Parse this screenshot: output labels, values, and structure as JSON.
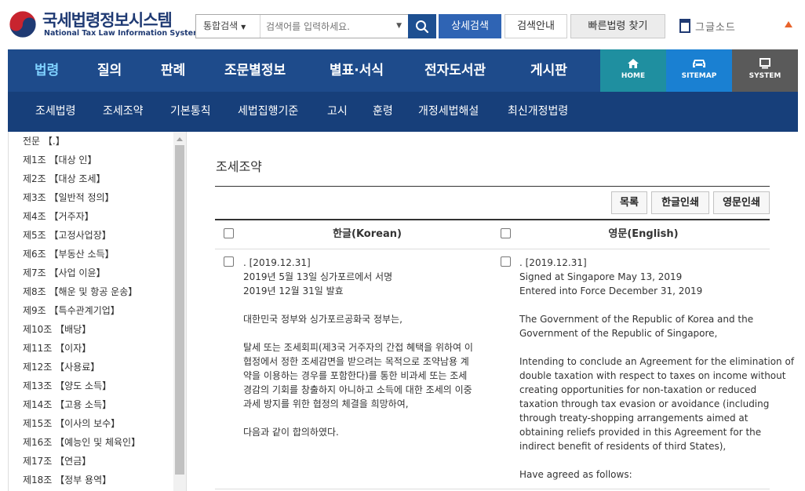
{
  "logo": {
    "title_ko": "국세법령정보시스템",
    "title_en": "National Tax Law Information System"
  },
  "search": {
    "scope": "통합검색",
    "placeholder": "검색어를 입력하세요.",
    "detail_button": "상세검색",
    "guide_button": "검색안내",
    "quick_button": "빠른법령 찾기"
  },
  "header": {
    "util_text": "그글소드"
  },
  "nav": {
    "main": [
      {
        "label": "법령",
        "active": true
      },
      {
        "label": "질의"
      },
      {
        "label": "판례"
      },
      {
        "label": "조문별정보"
      },
      {
        "label": "별표·서식"
      },
      {
        "label": "전자도서관"
      },
      {
        "label": "게시판"
      }
    ],
    "sub": [
      "조세법령",
      "조세조약",
      "기본통칙",
      "세법집행기준",
      "고시",
      "훈령",
      "개정세법해설",
      "최신개정법령"
    ],
    "quick": {
      "home": "HOME",
      "sitemap": "SITEMAP",
      "system": "SYSTEM"
    },
    "colors": {
      "nav_bg": "#1e4b8b",
      "sub_bg": "#173f7a",
      "active": "#7fd1ff",
      "home": "#1f8fa0",
      "sitemap": "#1a80d2",
      "system": "#5a5a5a"
    }
  },
  "sidebar": {
    "items": [
      "전문 【.】",
      "제1조 【대상 인】",
      "제2조 【대상 조세】",
      "제3조 【일반적 정의】",
      "제4조 【거주자】",
      "제5조 【고정사업장】",
      "제6조 【부동산 소득】",
      "제7조 【사업 이윤】",
      "제8조 【해운 및 항공 운송】",
      "제9조 【특수관계기업】",
      "제10조 【배당】",
      "제11조 【이자】",
      "제12조 【사용료】",
      "제13조 【양도 소득】",
      "제14조 【고용 소득】",
      "제15조 【이사의 보수】",
      "제16조 【예능인 및 체육인】",
      "제17조 【연금】",
      "제18조 【정부 용역】"
    ]
  },
  "content": {
    "title": "조세조약",
    "buttons": {
      "list": "목록",
      "print_ko": "한글인쇄",
      "print_en": "영문인쇄"
    },
    "columns": {
      "korean": "한글(Korean)",
      "english": "영문(English)"
    },
    "korean_lines": [
      ". [2019.12.31]",
      "2019년 5월 13일 싱가포르에서 서명",
      "2019년 12월 31일 발효",
      "",
      "대한민국 정부와 싱가포르공화국 정부는,",
      "",
      "탈세 또는 조세회피(제3국 거주자의 간접 혜택을 위하여 이",
      "협정에서 정한 조세감면을 받으려는 목적으로 조약남용 계",
      "약을 이용하는 경우를 포함한다)를 통한 비과세 또는 조세",
      "경감의 기회를 창출하지 아니하고 소득에 대한 조세의 이중",
      "과세 방지를 위한 협정의 체결을 희망하여,",
      "",
      "다음과 같이 합의하였다."
    ],
    "english_lines": [
      ". [2019.12.31]",
      "Signed at Singapore May 13, 2019",
      "Entered into Force December 31, 2019",
      "",
      "The Government of the Republic of Korea and the",
      "Government of the Republic of Singapore,",
      "",
      "Intending to conclude an Agreement for the elimination of",
      "double taxation with respect to taxes on income without",
      "creating opportunities for non-taxation or reduced",
      "taxation through tax evasion or avoidance (including",
      "through treaty-shopping arrangements aimed at",
      "obtaining reliefs provided in this Agreement for the",
      "indirect benefit of residents of third States),",
      "",
      "Have agreed as follows:"
    ]
  }
}
